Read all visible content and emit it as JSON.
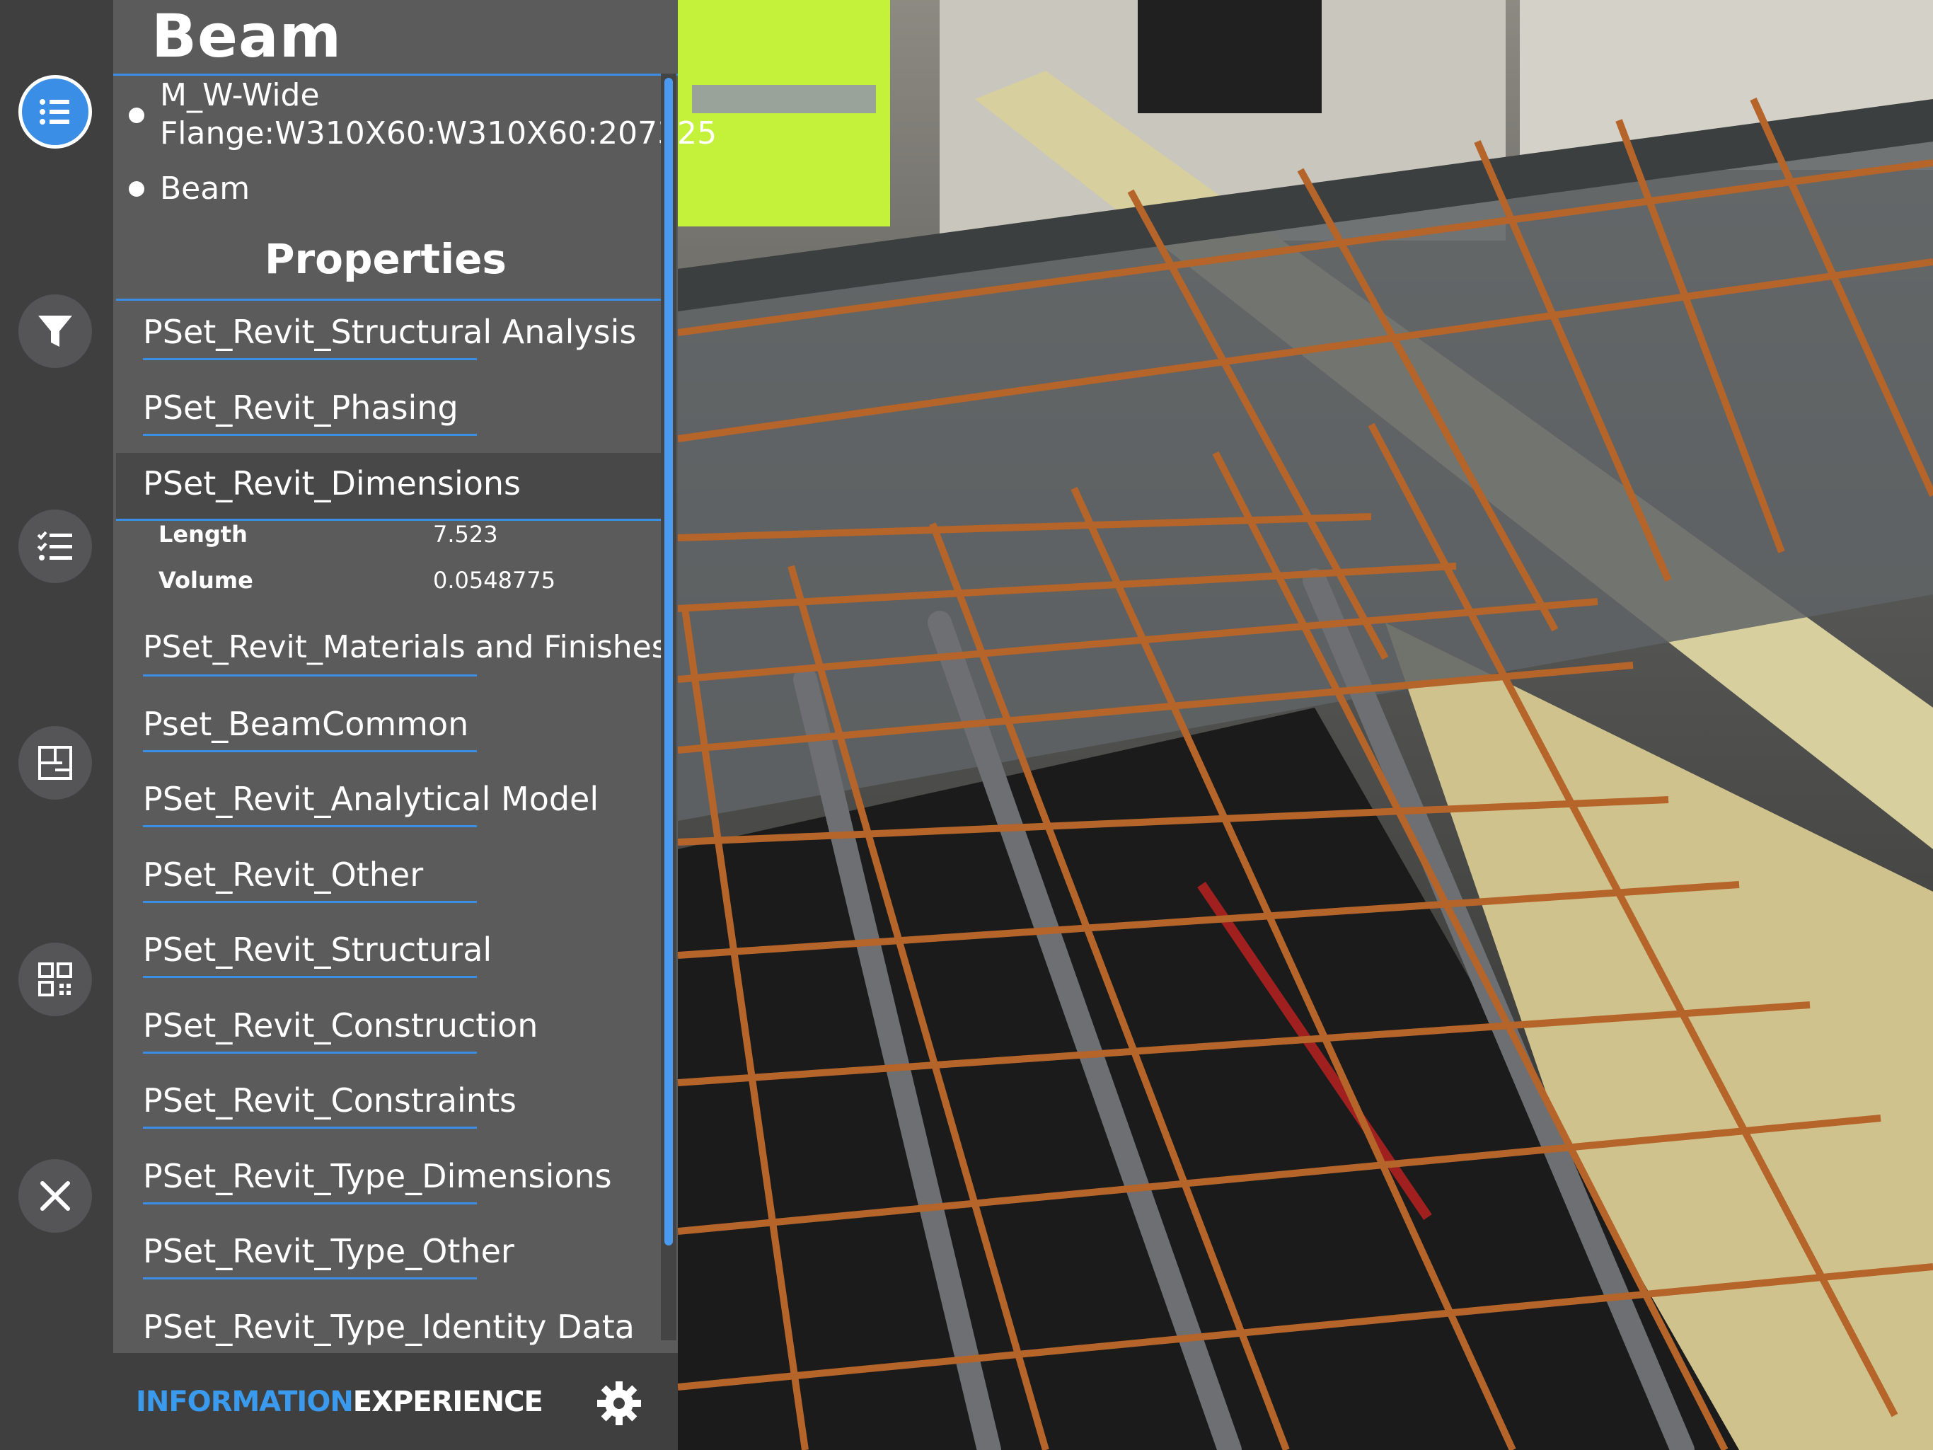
{
  "panel": {
    "title": "Beam",
    "element_info": [
      "M_W-Wide Flange:W310X60:W310X60:207325",
      "Beam"
    ],
    "properties_heading": "Properties",
    "psets": [
      "PSet_Revit_Structural Analysis",
      "PSet_Revit_Phasing",
      "PSet_Revit_Dimensions",
      "PSet_Revit_Materials and Finishes",
      "Pset_BeamCommon",
      "PSet_Revit_Analytical Model",
      "PSet_Revit_Other",
      "PSet_Revit_Structural",
      "PSet_Revit_Construction",
      "PSet_Revit_Constraints",
      "PSet_Revit_Type_Dimensions",
      "PSet_Revit_Type_Other",
      "PSet_Revit_Type_Identity Data"
    ],
    "selected_pset": "PSet_Revit_Dimensions",
    "dimension_props": [
      {
        "key": "Length",
        "value": "7.523"
      },
      {
        "key": "Volume",
        "value": "0.0548775"
      }
    ]
  },
  "rail": {
    "buttons": [
      "list-icon",
      "filter-icon",
      "checklist-icon",
      "floorplan-icon",
      "qr-code-icon",
      "close-icon"
    ],
    "active": "list-icon"
  },
  "footer": {
    "brand_part1": "INFORMATION",
    "brand_part2": "EXPERIENCE"
  },
  "colors": {
    "accent": "#3a8ee6",
    "panel_bg": "#5b5b5b",
    "rail_bg": "#3f3f3f",
    "rebar": "#b5642a"
  }
}
